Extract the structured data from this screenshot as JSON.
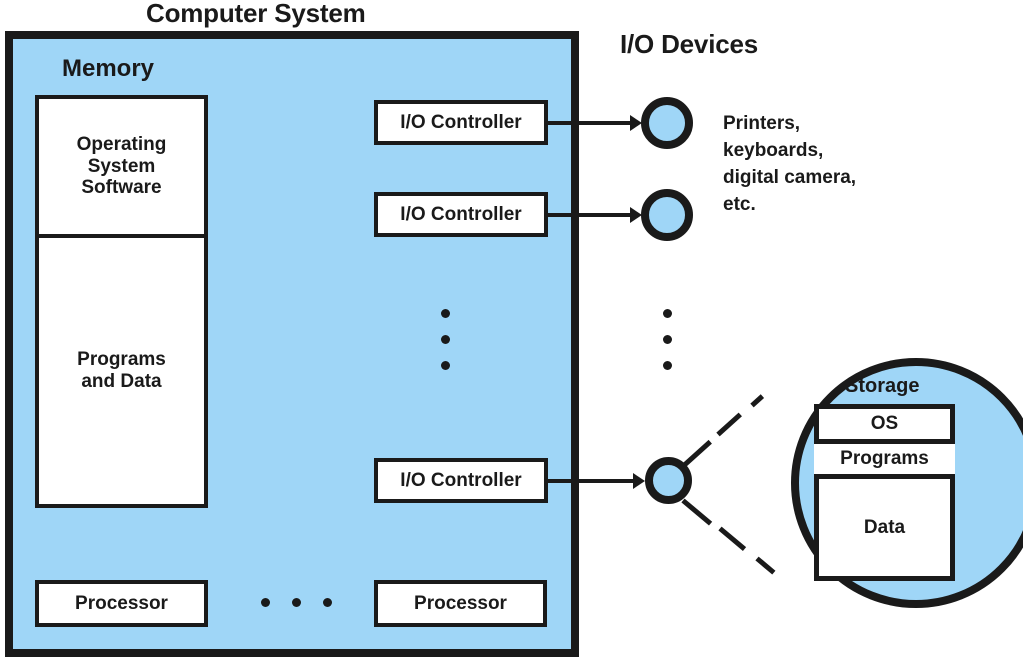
{
  "diagram": {
    "titles": {
      "computer_system": "Computer System",
      "io_devices": "I/O Devices"
    },
    "colors": {
      "fill_blue": "#9FD6F7",
      "stroke_black": "#1A1A1A",
      "box_white": "#FFFFFF"
    },
    "memory": {
      "label": "Memory",
      "blocks": [
        {
          "id": "os-software",
          "label": "Operating\nSystem\nSoftware"
        },
        {
          "id": "programs-data",
          "label": "Programs\nand Data"
        }
      ]
    },
    "io_controllers": [
      {
        "id": "io-controller-1",
        "label": "I/O Controller"
      },
      {
        "id": "io-controller-2",
        "label": "I/O Controller"
      },
      {
        "id": "io-controller-3",
        "label": "I/O Controller"
      }
    ],
    "processors": [
      {
        "id": "processor-1",
        "label": "Processor"
      },
      {
        "id": "processor-2",
        "label": "Processor"
      }
    ],
    "ellipses": {
      "io_controllers_vertical": "3 dots",
      "io_devices_vertical": "3 dots",
      "processors_horizontal": "3 dots"
    },
    "devices": {
      "list_label": "Printers,\nkeyboards,\ndigital camera,\netc."
    },
    "storage": {
      "label": "Storage",
      "rows": [
        {
          "id": "storage-os",
          "label": "OS"
        },
        {
          "id": "storage-programs",
          "label": "Programs"
        },
        {
          "id": "storage-data",
          "label": "Data"
        }
      ]
    }
  }
}
